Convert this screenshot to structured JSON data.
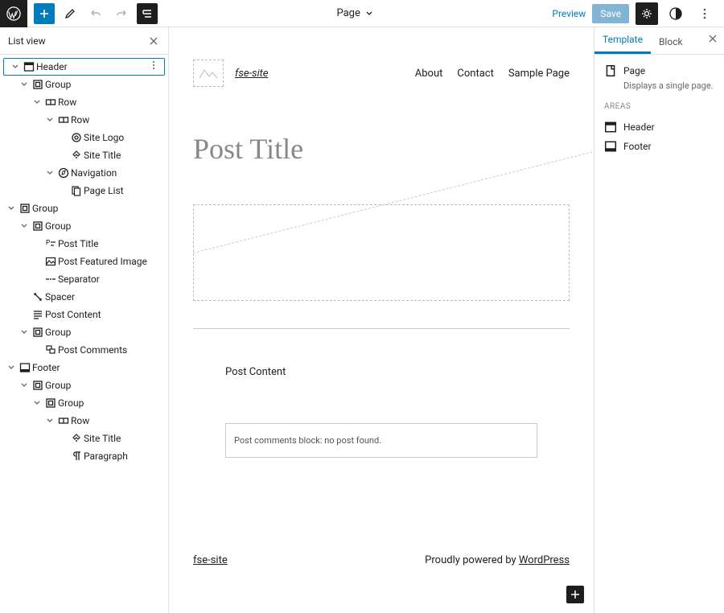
{
  "topbar": {
    "doc_type": "Page",
    "preview": "Preview",
    "save": "Save"
  },
  "left_panel": {
    "title": "List view",
    "tree": [
      {
        "d": 0,
        "t": "v",
        "i": "header",
        "l": "Header",
        "sel": true,
        "more": true
      },
      {
        "d": 1,
        "t": "v",
        "i": "group",
        "l": "Group"
      },
      {
        "d": 2,
        "t": "v",
        "i": "row",
        "l": "Row"
      },
      {
        "d": 3,
        "t": "v",
        "i": "row",
        "l": "Row"
      },
      {
        "d": 4,
        "t": "",
        "i": "sitelogo",
        "l": "Site Logo"
      },
      {
        "d": 4,
        "t": "",
        "i": "sitetitle",
        "l": "Site Title"
      },
      {
        "d": 3,
        "t": "v",
        "i": "nav",
        "l": "Navigation"
      },
      {
        "d": 4,
        "t": "",
        "i": "pagelist",
        "l": "Page List"
      },
      {
        "d": 0,
        "t": "v",
        "i": "group",
        "l": "Group"
      },
      {
        "d": 1,
        "t": "v",
        "i": "group",
        "l": "Group"
      },
      {
        "d": 2,
        "t": "",
        "i": "posttitle",
        "l": "Post Title"
      },
      {
        "d": 2,
        "t": "",
        "i": "featured",
        "l": "Post Featured Image"
      },
      {
        "d": 2,
        "t": "",
        "i": "separator",
        "l": "Separator"
      },
      {
        "d": 1,
        "t": "",
        "i": "spacer",
        "l": "Spacer"
      },
      {
        "d": 1,
        "t": "",
        "i": "postcontent",
        "l": "Post Content"
      },
      {
        "d": 1,
        "t": "v",
        "i": "group",
        "l": "Group"
      },
      {
        "d": 2,
        "t": "",
        "i": "comments",
        "l": "Post Comments"
      },
      {
        "d": 0,
        "t": "v",
        "i": "footer",
        "l": "Footer"
      },
      {
        "d": 1,
        "t": "v",
        "i": "group",
        "l": "Group"
      },
      {
        "d": 2,
        "t": "v",
        "i": "group",
        "l": "Group"
      },
      {
        "d": 3,
        "t": "v",
        "i": "row",
        "l": "Row"
      },
      {
        "d": 4,
        "t": "",
        "i": "sitetitle",
        "l": "Site Title"
      },
      {
        "d": 4,
        "t": "",
        "i": "paragraph",
        "l": "Paragraph"
      }
    ]
  },
  "canvas": {
    "site_title": "fse-site",
    "nav": [
      "About",
      "Contact",
      "Sample Page"
    ],
    "post_title": "Post Title",
    "post_content": "Post Content",
    "comments_msg": "Post comments block: no post found.",
    "footer_site": "fse-site",
    "footer_credit_prefix": "Proudly powered by ",
    "footer_credit_link": "WordPress"
  },
  "right_panel": {
    "tabs": [
      "Template",
      "Block"
    ],
    "page_label": "Page",
    "page_desc": "Displays a single page.",
    "areas_label": "AREAS",
    "areas": [
      {
        "i": "header",
        "l": "Header"
      },
      {
        "i": "footer",
        "l": "Footer"
      }
    ]
  }
}
